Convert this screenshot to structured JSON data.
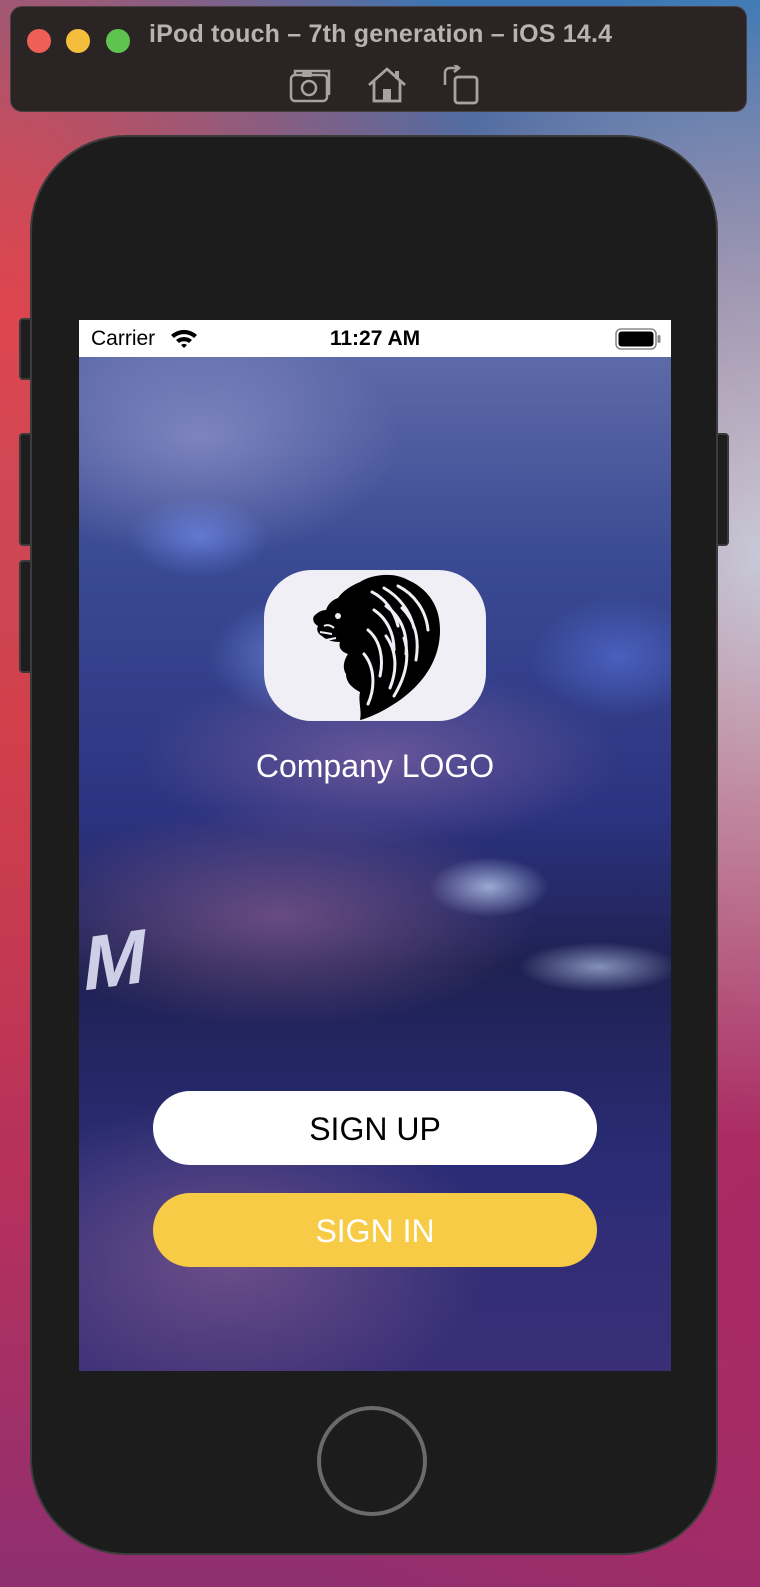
{
  "window": {
    "title": "iPod touch – 7th generation – iOS 14.4",
    "toolbar_icons": [
      "screenshot-icon",
      "home-icon",
      "rotate-icon"
    ]
  },
  "status_bar": {
    "carrier": "Carrier",
    "time": "11:27 AM",
    "wifi_icon": "wifi-icon",
    "battery_icon": "battery-icon"
  },
  "app": {
    "logo_icon": "lion-logo-icon",
    "company_label": "Company LOGO",
    "sign_up_label": "SIGN UP",
    "sign_in_label": "SIGN IN",
    "background_letter": "M"
  },
  "colors": {
    "sign_in_button": "#f7cb45",
    "sign_up_button": "#ffffff",
    "logo_card": "#f0eff5"
  }
}
